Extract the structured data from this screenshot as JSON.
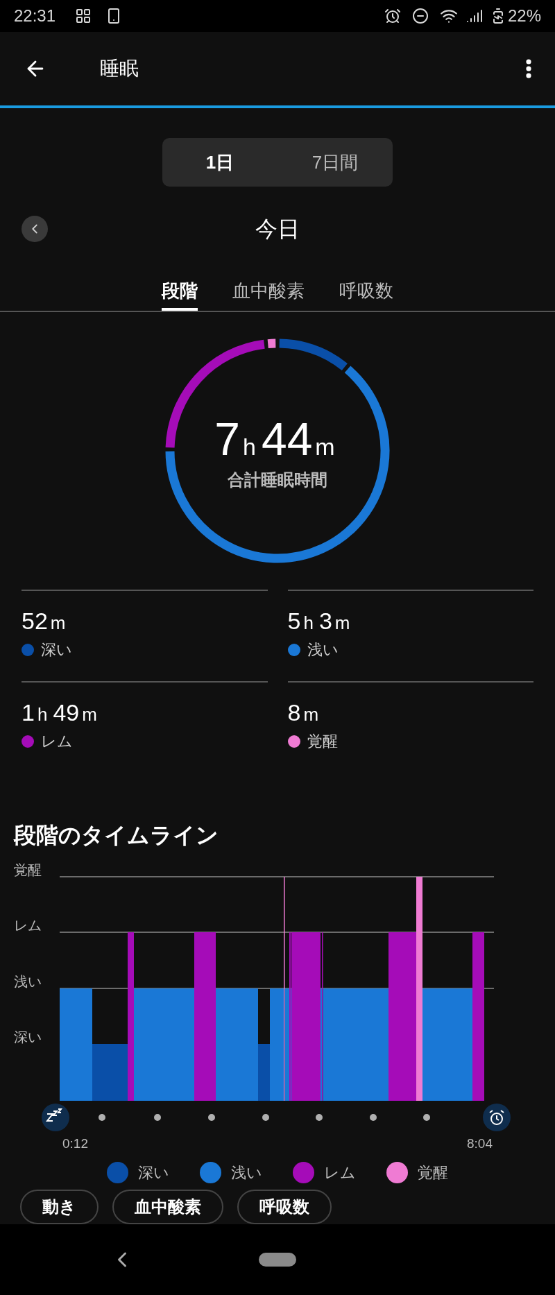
{
  "status_bar": {
    "time": "22:31",
    "battery": "22%"
  },
  "app_bar": {
    "title": "睡眠"
  },
  "period_toggle": [
    {
      "label": "1日",
      "selected": true
    },
    {
      "label": "7日間",
      "selected": false
    }
  ],
  "date_nav": {
    "label": "今日"
  },
  "tabs": [
    {
      "label": "段階",
      "selected": true
    },
    {
      "label": "血中酸素",
      "selected": false
    },
    {
      "label": "呼吸数",
      "selected": false
    }
  ],
  "summary": {
    "total_parts": [
      "7",
      "h",
      "44",
      "m"
    ],
    "caption": "合計睡眠時間"
  },
  "stats": [
    {
      "parts": [
        "52",
        "m"
      ],
      "label": "深い",
      "color": "#0a4fa8"
    },
    {
      "parts": [
        "5",
        "h",
        "3",
        "m"
      ],
      "label": "浅い",
      "color": "#1a78d6"
    },
    {
      "parts": [
        "1",
        "h",
        "49",
        "m"
      ],
      "label": "レム",
      "color": "#a50cb8"
    },
    {
      "parts": [
        "8",
        "m"
      ],
      "label": "覚醒",
      "color": "#ef7bd3"
    }
  ],
  "timeline": {
    "title": "段階のタイムライン",
    "levels": [
      "覚醒",
      "レム",
      "浅い",
      "深い"
    ],
    "start": "0:12",
    "end": "8:04"
  },
  "legend": [
    {
      "label": "深い",
      "color": "#0a4fa8"
    },
    {
      "label": "浅い",
      "color": "#1a78d6"
    },
    {
      "label": "レム",
      "color": "#a50cb8"
    },
    {
      "label": "覚醒",
      "color": "#ef7bd3"
    }
  ],
  "chips": [
    "動き",
    "血中酸素",
    "呼吸数"
  ]
}
